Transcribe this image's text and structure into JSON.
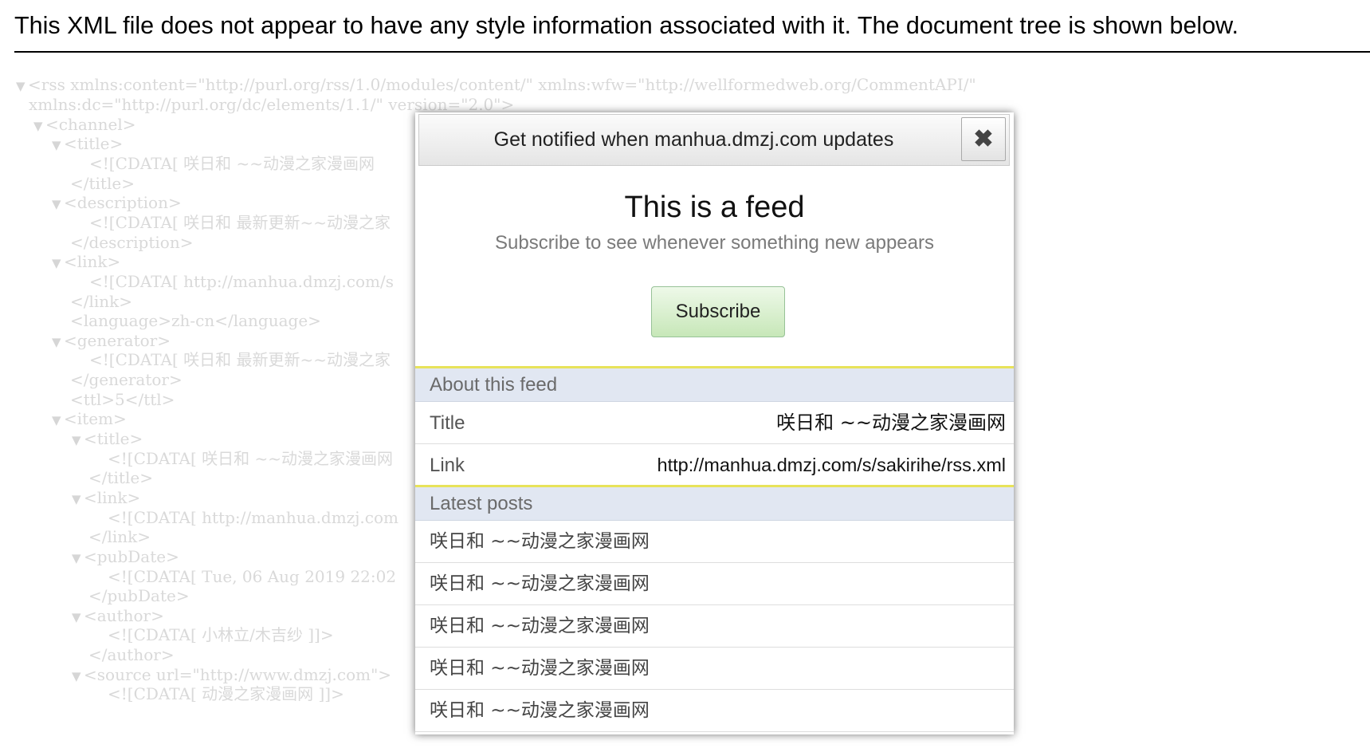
{
  "xml_notice": "This XML file does not appear to have any style information associated with it. The document tree is shown below.",
  "xml_tree": {
    "lines": [
      "<rss xmlns:content=\"http://purl.org/rss/1.0/modules/content/\" xmlns:wfw=\"http://wellformedweb.org/CommentAPI/\"",
      "xmlns:dc=\"http://purl.org/dc/elements/1.1/\" version=\"2.0\">",
      "<channel>",
      "<title>",
      "<![CDATA[ 咲日和 ~~动漫之家漫画网",
      "</title>",
      "<description>",
      "<![CDATA[ 咲日和 最新更新~~动漫之家",
      "</description>",
      "<link>",
      "<![CDATA[ http://manhua.dmzj.com/s",
      "</link>",
      "<language>zh-cn</language>",
      "<generator>",
      "<![CDATA[ 咲日和 最新更新~~动漫之家",
      "</generator>",
      "<ttl>5</ttl>",
      "<item>",
      "<title>",
      "<![CDATA[ 咲日和 ~~动漫之家漫画网",
      "</title>",
      "<link>",
      "<![CDATA[ http://manhua.dmzj.com",
      "</link>",
      "<pubDate>",
      "<![CDATA[ Tue, 06 Aug 2019 22:02",
      "</pubDate>",
      "<author>",
      "<![CDATA[ 小林立/木吉纱 ]]>",
      "</author>",
      "<source url=\"http://www.dmzj.com\">",
      "<![CDATA[ 动漫之家漫画网 ]]>"
    ],
    "toggle_symbol": "▼"
  },
  "popup": {
    "title": "Get notified when manhua.dmzj.com updates",
    "close_icon": "close-icon",
    "heading": "This is a feed",
    "subheading": "Subscribe to see whenever something new appears",
    "subscribe_label": "Subscribe",
    "about": {
      "header": "About this feed",
      "rows": [
        {
          "label": "Title",
          "value": "咲日和 ~~动漫之家漫画网"
        },
        {
          "label": "Link",
          "value": "http://manhua.dmzj.com/s/sakirihe/rss.xml"
        }
      ]
    },
    "latest": {
      "header": "Latest posts",
      "posts": [
        "咲日和 ~~动漫之家漫画网",
        "咲日和 ~~动漫之家漫画网",
        "咲日和 ~~动漫之家漫画网",
        "咲日和 ~~动漫之家漫画网",
        "咲日和 ~~动漫之家漫画网"
      ]
    }
  },
  "colors": {
    "section_header_bg": "#e1e7f2",
    "section_accent": "#e8e35a",
    "subscribe_green": "#c7e7b8"
  }
}
